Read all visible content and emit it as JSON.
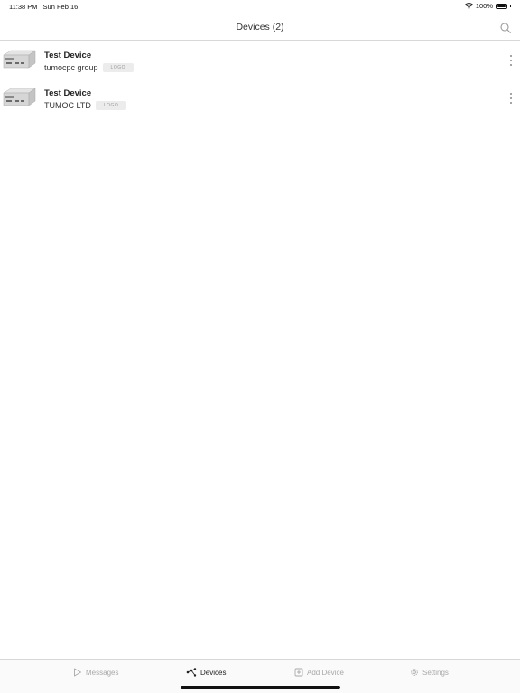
{
  "status_bar": {
    "time": "11:38 PM",
    "date": "Sun Feb 16",
    "battery": "100%",
    "battery_level": 1.0
  },
  "nav": {
    "title": "Devices (2)",
    "search_icon": "search-icon"
  },
  "devices": [
    {
      "name": "Test Device",
      "group": "tumocpc group",
      "badge": "LOGO",
      "thumb_icon": "device-thumbnail",
      "menu_icon": "more-vertical-icon"
    },
    {
      "name": "Test Device",
      "group": "TUMOC LTD",
      "badge": "LOGO",
      "thumb_icon": "device-thumbnail",
      "menu_icon": "more-vertical-icon"
    }
  ],
  "tabs": [
    {
      "label": "Messages",
      "icon": "play-icon",
      "active": false
    },
    {
      "label": "Devices",
      "icon": "network-icon",
      "active": true
    },
    {
      "label": "Add Device",
      "icon": "plus-square-icon",
      "active": false
    },
    {
      "label": "Settings",
      "icon": "gear-icon",
      "active": false
    }
  ],
  "colors": {
    "active_tab": "#222222",
    "inactive_tab": "#a8a8a8",
    "badge_bg": "#ececec"
  }
}
